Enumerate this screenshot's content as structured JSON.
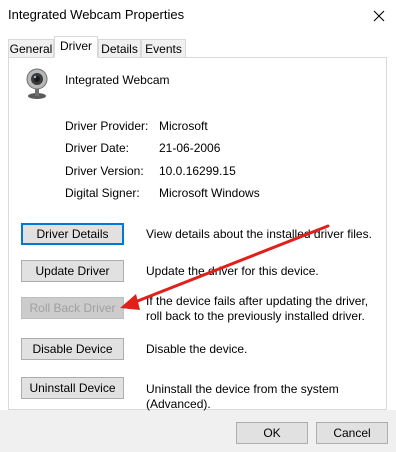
{
  "window": {
    "title": "Integrated Webcam Properties"
  },
  "tabs": [
    {
      "label": "General"
    },
    {
      "label": "Driver"
    },
    {
      "label": "Details"
    },
    {
      "label": "Events"
    }
  ],
  "device": {
    "name": "Integrated Webcam",
    "icon": "webcam-icon"
  },
  "properties": [
    {
      "label": "Driver Provider:",
      "value": "Microsoft"
    },
    {
      "label": "Driver Date:",
      "value": "21-06-2006"
    },
    {
      "label": "Driver Version:",
      "value": "10.0.16299.15"
    },
    {
      "label": "Digital Signer:",
      "value": "Microsoft Windows"
    }
  ],
  "actions": [
    {
      "button": "Driver Details",
      "description": "View details about the installed driver files."
    },
    {
      "button": "Update Driver",
      "description": "Update the driver for this device."
    },
    {
      "button": "Roll Back Driver",
      "description": "If the device fails after updating the driver, roll back to the previously installed driver."
    },
    {
      "button": "Disable Device",
      "description": "Disable the device."
    },
    {
      "button": "Uninstall Device",
      "description": "Uninstall the device from the system (Advanced)."
    }
  ],
  "dialog_buttons": {
    "ok": "OK",
    "cancel": "Cancel"
  },
  "annotation": {
    "arrow_color": "#e0201b"
  }
}
